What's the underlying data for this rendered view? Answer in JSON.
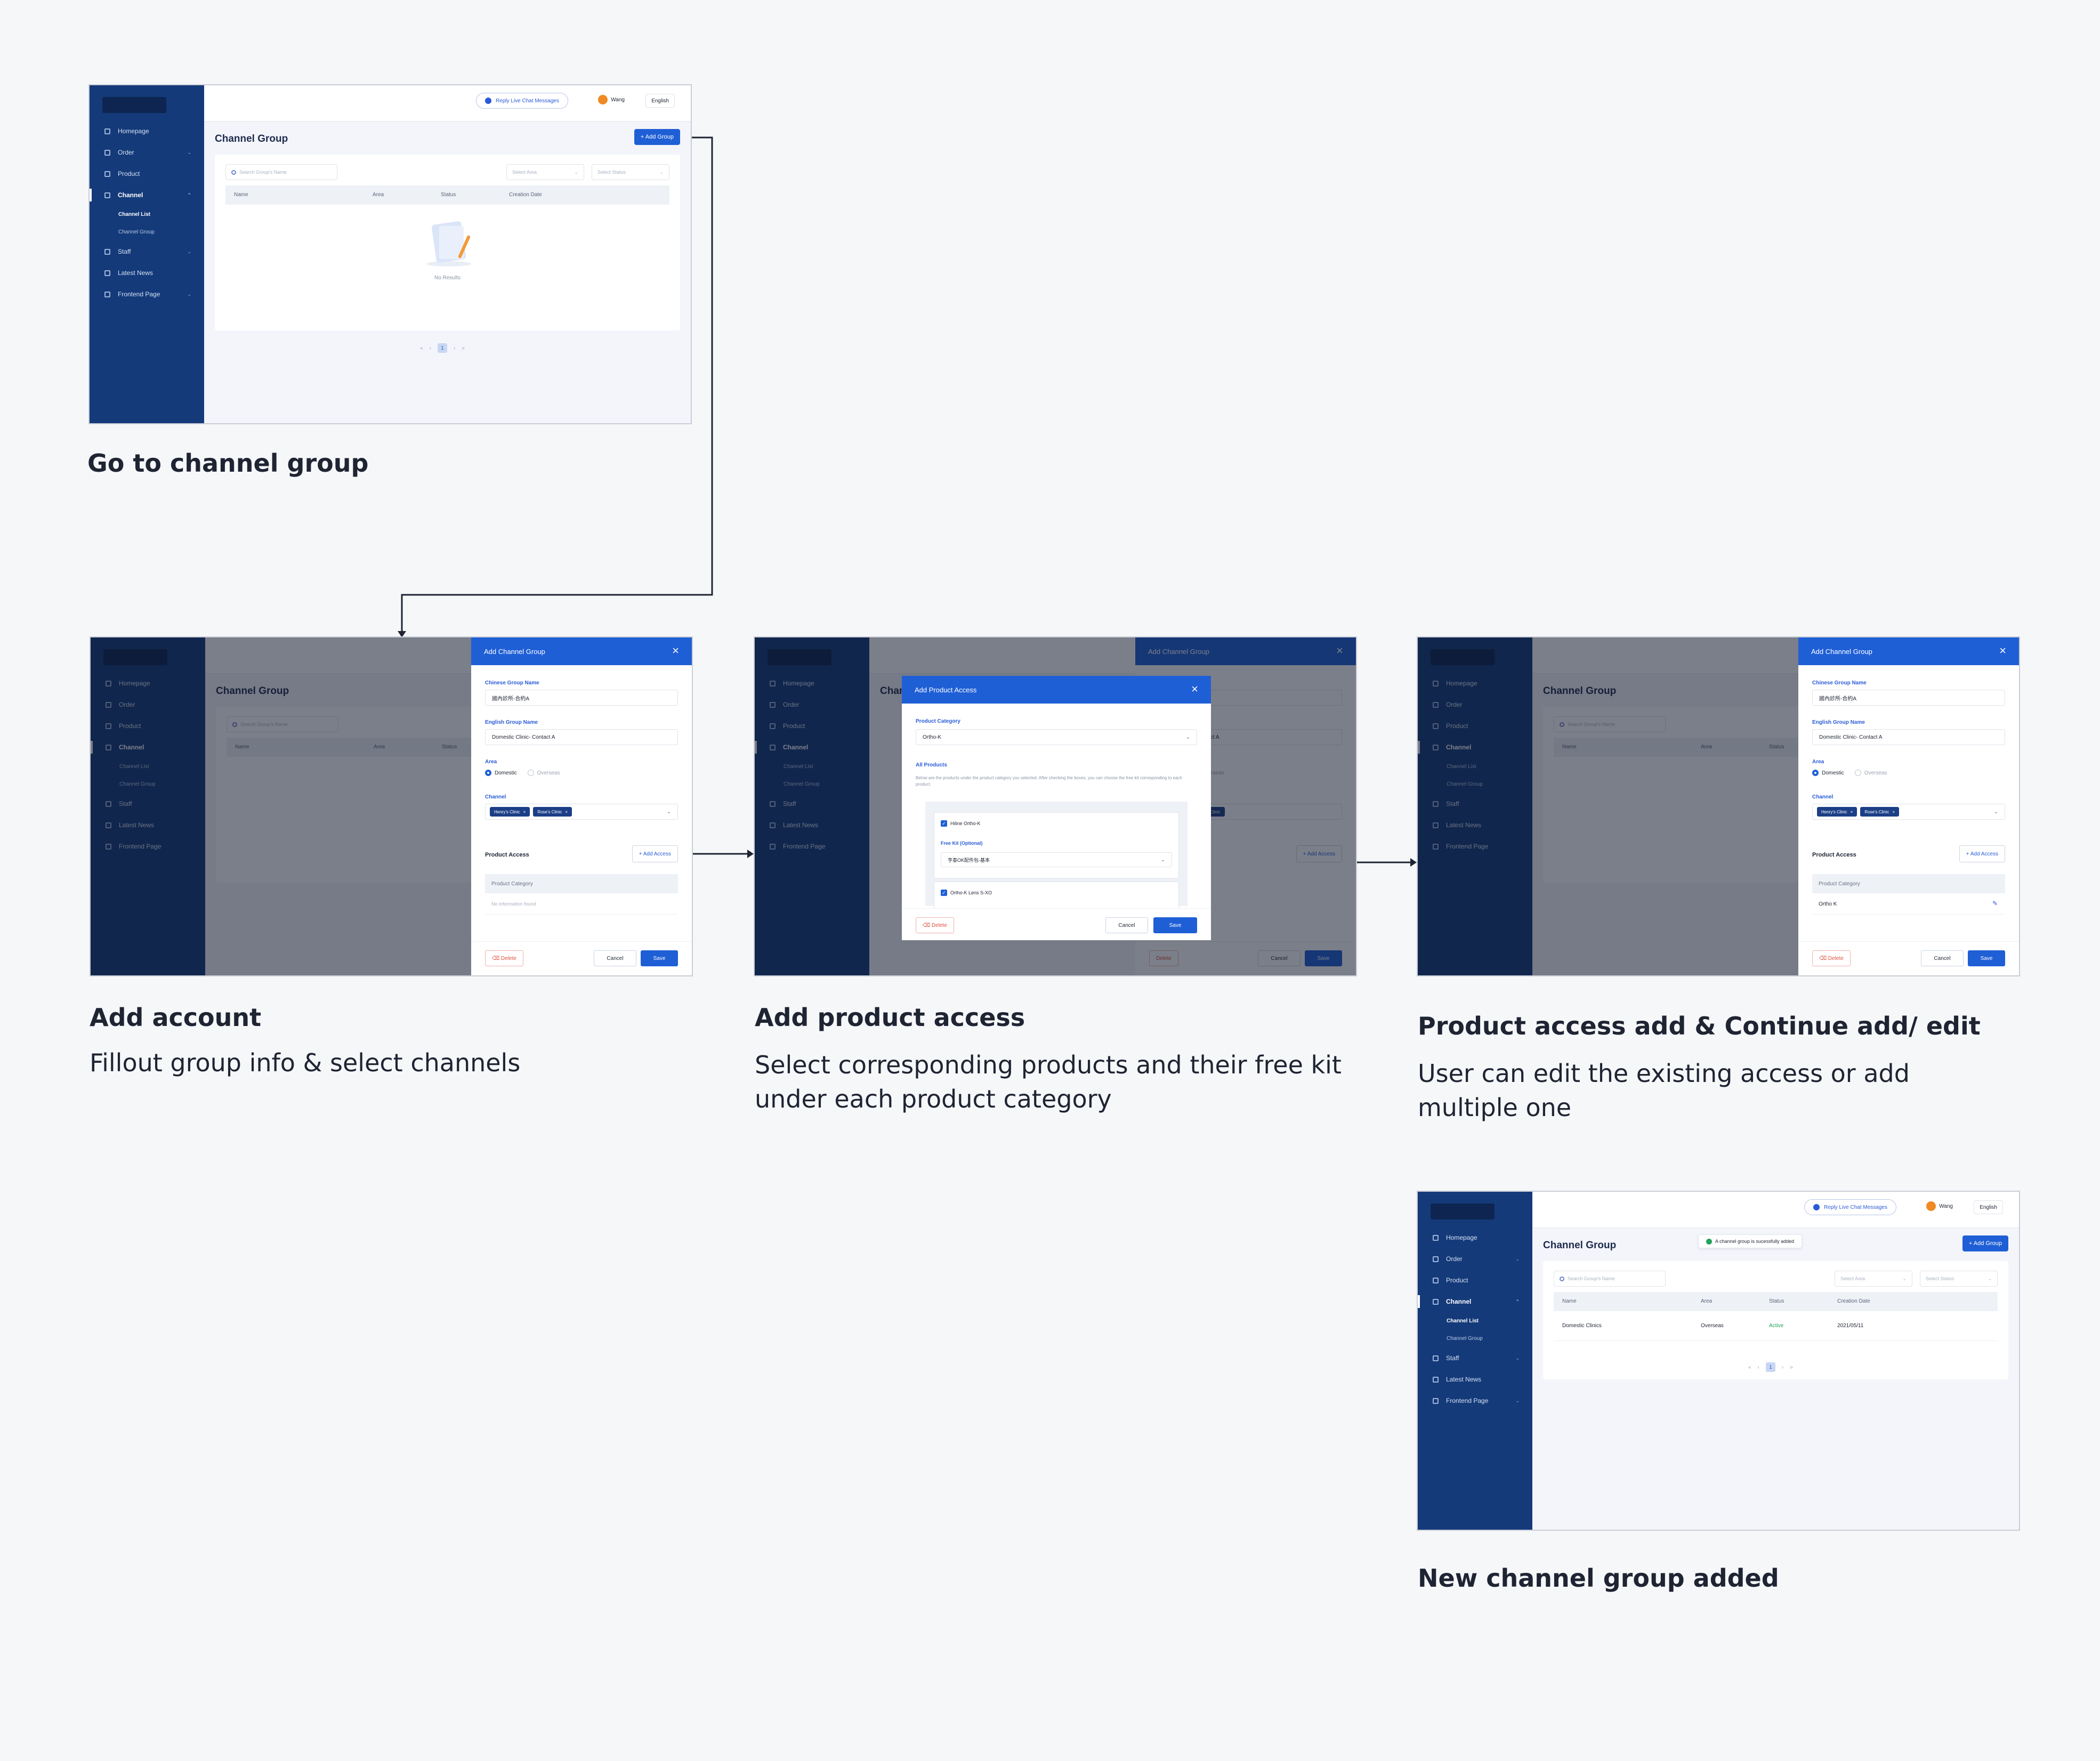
{
  "sidebar": {
    "items": [
      {
        "label": "Homepage",
        "icon": "home-icon",
        "chevron": ""
      },
      {
        "label": "Order",
        "icon": "order-icon",
        "chevron": "⌄"
      },
      {
        "label": "Product",
        "icon": "product-icon",
        "chevron": ""
      },
      {
        "label": "Channel",
        "icon": "channel-icon",
        "chevron": "⌃"
      },
      {
        "label": "Staff",
        "icon": "staff-icon",
        "chevron": "⌄"
      },
      {
        "label": "Latest News",
        "icon": "news-icon",
        "chevron": ""
      },
      {
        "label": "Frontend Page",
        "icon": "frontend-icon",
        "chevron": "⌄"
      }
    ],
    "subitems": [
      "Channel List",
      "Channel Group"
    ]
  },
  "topbar": {
    "reply_label": "Reply Live Chat Messages",
    "user": "Wang",
    "avatar_initial": "W",
    "language": "English"
  },
  "page": {
    "title": "Channel Group",
    "add_group": "+ Add Group",
    "search_placeholder": "Search Group's Name",
    "select_area": "Select Area",
    "select_status": "Select Status",
    "columns": [
      "Name",
      "Area",
      "Status",
      "Creation Date"
    ],
    "empty": "No Results",
    "page_number": "1",
    "toast": "A channel group is sucessfully added"
  },
  "new_row": {
    "name": "Domestic Clinics",
    "area": "Overseas",
    "status": "Active",
    "date": "2021/05/11"
  },
  "drawer": {
    "title": "Add Channel Group",
    "cn_label": "Chinese Group Name",
    "cn_value": "國內診所-合約A",
    "en_label": "English Group Name",
    "en_value": "Domestic Clinic- Contact A",
    "area_label": "Area",
    "area_on": "Domestic",
    "area_off": "Overseas",
    "channel_label": "Channel",
    "chips": [
      "Henry's Clinic",
      "Rose's Clinic"
    ],
    "product_access": "Product Access",
    "add_access": "+ Add Access",
    "product_category": "Product Category",
    "no_info": "No information found",
    "category_value": "Ortho K",
    "delete": "Delete",
    "cancel": "Cancel",
    "save": "Save"
  },
  "modal": {
    "title": "Add Product Access",
    "category_label": "Product Category",
    "category_value": "Ortho-K",
    "all_products": "All Products",
    "desc": "Below are the products under the product category you selected. After checking the boxes, you can choose the free kit corresponding to each product.",
    "product1": "Hiline Ortho-K",
    "free_kit_label": "Free Kit (Optional)",
    "free_kit_value": "亨泰OK配件包-基本",
    "product2": "Ortho-K Lens S-XO"
  },
  "captions": {
    "step1": "Go to channel group",
    "step2_title": "Add account",
    "step2_sub": "Fillout group info & select channels",
    "step3_title": "Add product access",
    "step3_sub_1": "Select corresponding products and their free kit",
    "step3_sub_2": "under each product category",
    "step4_title": "Product access add & Continue add/ edit",
    "step4_sub_1": "User can edit the existing access or add",
    "step4_sub_2": "multiple one",
    "step5": "New channel group added"
  },
  "colors": {
    "sidebar": "#143a7a",
    "accent": "#1f5fd6",
    "active": "#22a35a",
    "danger": "#e0503f"
  }
}
